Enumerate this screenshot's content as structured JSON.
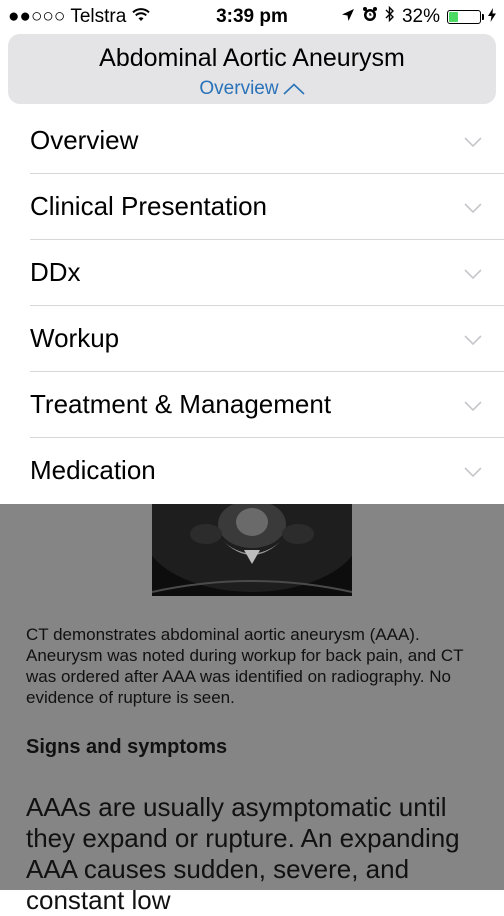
{
  "status_bar": {
    "signal": "●●○○○",
    "carrier": "Telstra",
    "time": "3:39 pm",
    "battery": "32%",
    "battery_level": 0.32,
    "icons": [
      "wifi-icon",
      "location-arrow-icon",
      "alarm-icon",
      "bluetooth-icon",
      "battery-icon",
      "charging-icon"
    ]
  },
  "header": {
    "title": "Abdominal Aortic Aneurysm",
    "subtitle": "Overview",
    "subtitle_color": "#2a73b8"
  },
  "menu": {
    "items": [
      {
        "label": "Overview"
      },
      {
        "label": "Clinical Presentation"
      },
      {
        "label": "DDx"
      },
      {
        "label": "Workup"
      },
      {
        "label": "Treatment & Management"
      },
      {
        "label": "Medication"
      }
    ]
  },
  "content": {
    "caption": "CT demonstrates abdominal aortic aneurysm (AAA). Aneurysm was noted during workup for back pain, and CT was ordered after AAA was identified on radiography. No evidence of rupture is seen.",
    "heading": "Signs and symptoms",
    "body": "AAAs are usually asymptomatic until they expand or rupture. An expanding AAA causes sudden, severe, and constant low"
  },
  "colors": {
    "overlay": "#858585",
    "header_bg": "#e4e4e6",
    "battery_fill": "#4cd964"
  }
}
